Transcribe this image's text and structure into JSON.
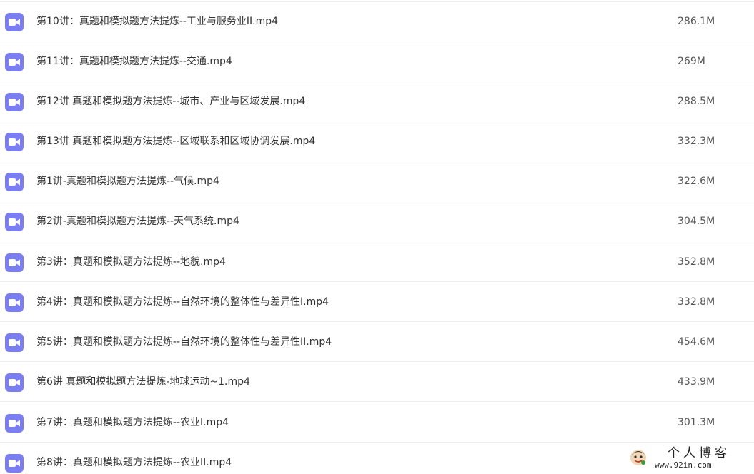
{
  "files": [
    {
      "name": "第10讲：真题和模拟题方法提炼--工业与服务业II.mp4",
      "size": "286.1M",
      "icon": "video-file-icon"
    },
    {
      "name": "第11讲：真题和模拟题方法提炼--交通.mp4",
      "size": "269M",
      "icon": "video-file-icon"
    },
    {
      "name": "第12讲 真题和模拟题方法提炼--城市、产业与区域发展.mp4",
      "size": "288.5M",
      "icon": "video-file-icon"
    },
    {
      "name": "第13讲 真题和模拟题方法提炼--区域联系和区域协调发展.mp4",
      "size": "332.3M",
      "icon": "video-file-icon"
    },
    {
      "name": "第1讲-真题和模拟题方法提炼--气候.mp4",
      "size": "322.6M",
      "icon": "video-file-icon"
    },
    {
      "name": "第2讲-真题和模拟题方法提炼--天气系统.mp4",
      "size": "304.5M",
      "icon": "video-file-icon"
    },
    {
      "name": "第3讲：真题和模拟题方法提炼--地貌.mp4",
      "size": "352.8M",
      "icon": "video-file-icon"
    },
    {
      "name": "第4讲：真题和模拟题方法提炼--自然环境的整体性与差异性I.mp4",
      "size": "332.8M",
      "icon": "video-file-icon"
    },
    {
      "name": "第5讲：真题和模拟题方法提炼--自然环境的整体性与差异性II.mp4",
      "size": "454.6M",
      "icon": "video-file-icon"
    },
    {
      "name": "第6讲 真题和模拟题方法提炼-地球运动~1.mp4",
      "size": "433.9M",
      "icon": "video-file-icon"
    },
    {
      "name": "第7讲：真题和模拟题方法提炼--农业I.mp4",
      "size": "301.3M",
      "icon": "video-file-icon"
    },
    {
      "name": "第8讲：真题和模拟题方法提炼--农业II.mp4",
      "size": "",
      "icon": "video-file-icon"
    }
  ],
  "watermark": {
    "title": "个人博客",
    "url": "www.92in.com"
  },
  "colors": {
    "icon_bg": "#7b7ef0",
    "divider": "#eeeeee",
    "text": "#333333"
  }
}
